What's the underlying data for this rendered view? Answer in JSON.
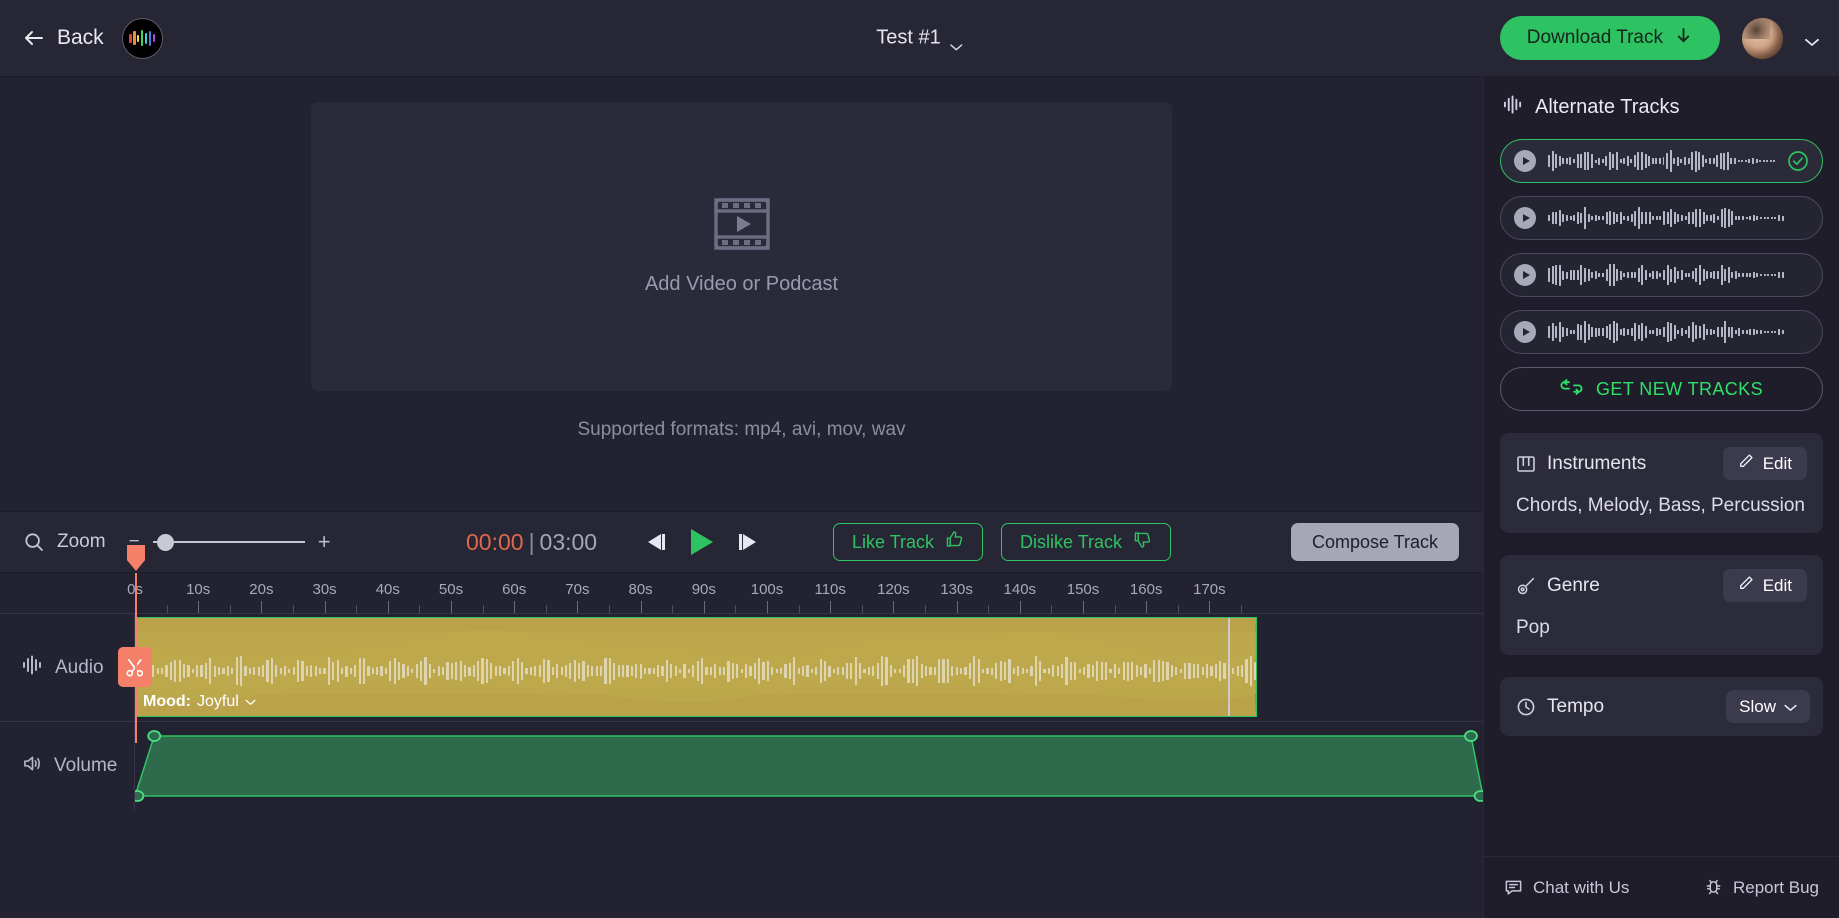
{
  "header": {
    "back_label": "Back",
    "back_icon": "arrow-left-icon",
    "logo_icon": "waveform-logo-icon",
    "logo_bars": [
      {
        "h": 9,
        "color": "#e0413c"
      },
      {
        "h": 14,
        "color": "#e8913a"
      },
      {
        "h": 7,
        "color": "#e8e03a"
      },
      {
        "h": 16,
        "color": "#49d45f"
      },
      {
        "h": 11,
        "color": "#3ad0d8"
      },
      {
        "h": 15,
        "color": "#4f7de8"
      },
      {
        "h": 8,
        "color": "#a44fe8"
      }
    ],
    "project_title": "Test #1",
    "project_chevron_icon": "chevron-down-icon",
    "download_label": "Download Track",
    "download_icon": "arrow-down-icon",
    "download_color": "#2ec362",
    "avatar_icon": "user-avatar",
    "avatar_chevron_icon": "chevron-down-icon"
  },
  "stage": {
    "dropzone_icon": "film-play-icon",
    "dropzone_label": "Add Video or Podcast",
    "formats_note": "Supported formats: mp4, avi, mov, wav"
  },
  "transport": {
    "zoom_icon": "search-icon",
    "zoom_label": "Zoom",
    "zoom_minus": "−",
    "zoom_plus": "+",
    "zoom_value": 4,
    "current_time": "00:00",
    "separator": "|",
    "total_time": "03:00",
    "current_time_color": "#e0684a",
    "skip_back_icon": "skip-back-icon",
    "play_icon": "play-icon",
    "skip_forward_icon": "skip-forward-icon",
    "play_color": "#2ec362",
    "like_label": "Like Track",
    "like_icon": "thumbs-up-icon",
    "dislike_label": "Dislike Track",
    "dislike_icon": "thumbs-down-icon",
    "compose_label": "Compose Track"
  },
  "timeline": {
    "ruler_ticks": [
      "0s",
      "10s",
      "20s",
      "30s",
      "40s",
      "50s",
      "60s",
      "70s",
      "80s",
      "90s",
      "100s",
      "110s",
      "120s",
      "130s",
      "140s",
      "150s",
      "160s",
      "170s"
    ],
    "playhead_position": "0s",
    "playhead_color": "#f4806a",
    "audio_track": {
      "label": "Audio",
      "icon": "audio-waveform-icon",
      "cut_icon": "scissors-icon",
      "cut_color": "#f4806a",
      "clip_color": "#a06a3e",
      "clip_border_color": "#2ec362",
      "wave_color": "#bca84c",
      "mood_label": "Mood:",
      "mood_value": "Joyful",
      "mood_chevron_icon": "chevron-down-icon"
    },
    "volume_track": {
      "label": "Volume",
      "icon": "speaker-icon",
      "envelope_color": "#2ec362",
      "envelope_fill": "#2e6b4d",
      "handles": 4
    }
  },
  "right_panel": {
    "section_icon": "audio-waveform-icon",
    "section_title": "Alternate Tracks",
    "tracks": [
      {
        "play_icon": "play-circle-icon",
        "selected": true,
        "check_icon": "check-circle-icon",
        "seed": 11
      },
      {
        "play_icon": "play-circle-icon",
        "selected": false,
        "check_icon": "",
        "seed": 27
      },
      {
        "play_icon": "play-circle-icon",
        "selected": false,
        "check_icon": "",
        "seed": 43
      },
      {
        "play_icon": "play-circle-icon",
        "selected": false,
        "check_icon": "",
        "seed": 61
      }
    ],
    "get_new_tracks_label": "GET NEW TRACKS",
    "get_new_tracks_icon": "refresh-icon",
    "get_new_tracks_color": "#2ee06a",
    "instruments": {
      "icon": "piano-icon",
      "title": "Instruments",
      "edit_label": "Edit",
      "edit_icon": "pencil-icon",
      "value": "Chords, Melody, Bass, Percussion"
    },
    "genre": {
      "icon": "guitar-icon",
      "title": "Genre",
      "edit_label": "Edit",
      "edit_icon": "pencil-icon",
      "value": "Pop"
    },
    "tempo": {
      "icon": "clock-icon",
      "title": "Tempo",
      "value": "Slow",
      "chevron_icon": "chevron-down-icon"
    },
    "footer": {
      "chat_label": "Chat with Us",
      "chat_icon": "chat-bubble-icon",
      "bug_label": "Report Bug",
      "bug_icon": "bug-icon"
    }
  }
}
